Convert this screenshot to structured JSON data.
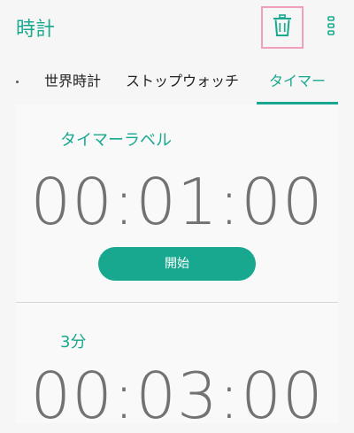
{
  "appbar": {
    "title": "時計",
    "delete_icon": "trash-icon",
    "overflow_icon": "more-vert-icon"
  },
  "tabs": [
    {
      "label": "世界時計"
    },
    {
      "label": "ストップウォッチ"
    },
    {
      "label": "タイマー",
      "selected": true
    }
  ],
  "timers": [
    {
      "label": "タイマーラベル",
      "time": "00:01:00",
      "button": "開始"
    },
    {
      "label": "3分",
      "time": "00:03:00"
    }
  ],
  "colors": {
    "accent": "#18a88f",
    "highlight_border": "#f0a0bd",
    "time_text": "#727272"
  }
}
